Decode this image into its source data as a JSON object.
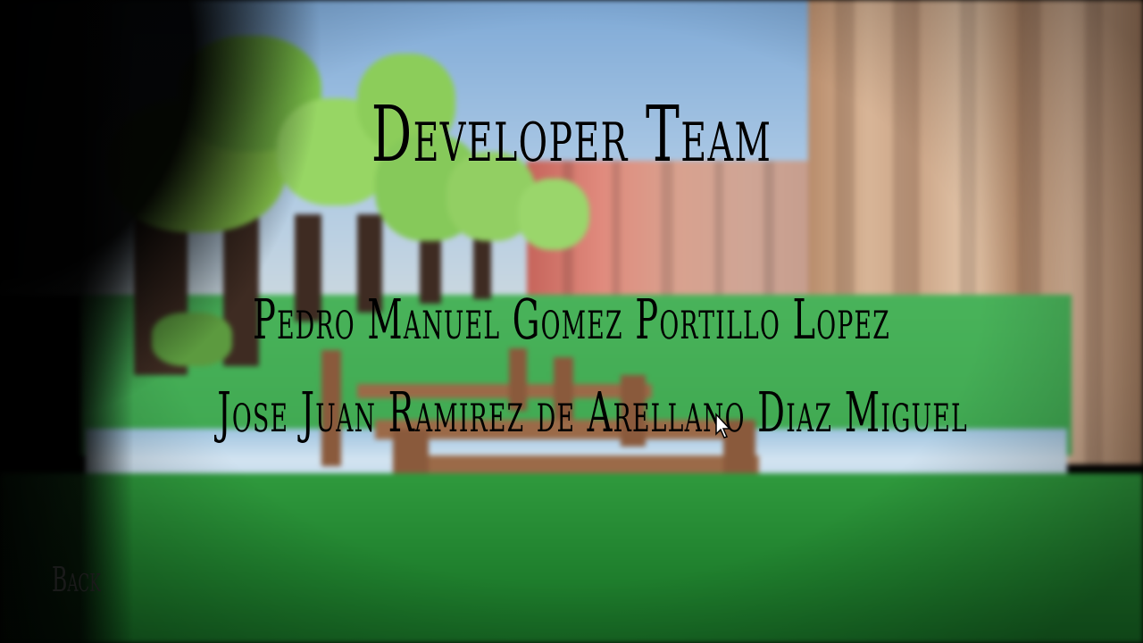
{
  "screen": {
    "title": "Developer Team",
    "credits": [
      "Pedro Manuel Gomez Portillo Lopez",
      "Jose Juan Ramirez de Arellano Diaz Miguel"
    ],
    "back_label": "Back"
  },
  "icons": {
    "cursor": "mouse-pointer-icon"
  },
  "colors": {
    "text": "#000000",
    "back_text": "#1a1a1a"
  }
}
